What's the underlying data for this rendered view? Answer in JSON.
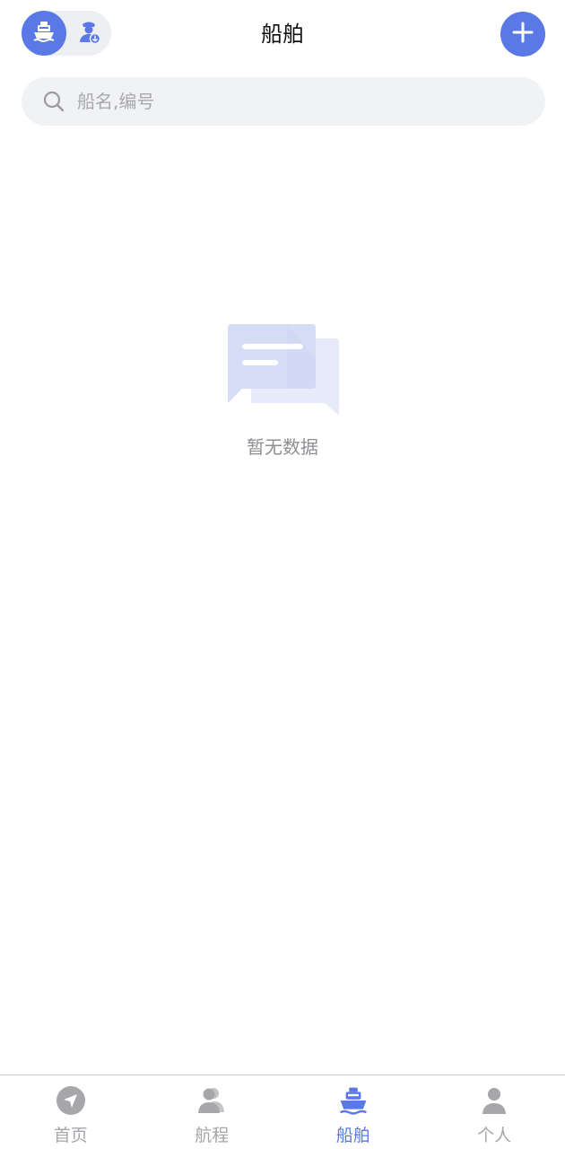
{
  "header": {
    "title": "船舶",
    "toggle": {
      "options": [
        {
          "icon": "ship-icon",
          "selected": true
        },
        {
          "icon": "captain-icon",
          "selected": false
        }
      ]
    },
    "add_button_icon": "plus-icon"
  },
  "search": {
    "placeholder": "船名,编号",
    "value": "",
    "icon": "search-icon"
  },
  "empty_state": {
    "icon": "message-bubbles-icon",
    "text": "暂无数据"
  },
  "tabbar": {
    "items": [
      {
        "label": "首页",
        "icon": "navigation-icon",
        "active": false
      },
      {
        "label": "航程",
        "icon": "people-icon",
        "active": false
      },
      {
        "label": "船舶",
        "icon": "ship-icon",
        "active": true
      },
      {
        "label": "个人",
        "icon": "person-icon",
        "active": false
      }
    ]
  },
  "colors": {
    "accent": "#5b79e6",
    "inactive": "#a6a6ab",
    "search_bg": "#f1f2f4"
  }
}
